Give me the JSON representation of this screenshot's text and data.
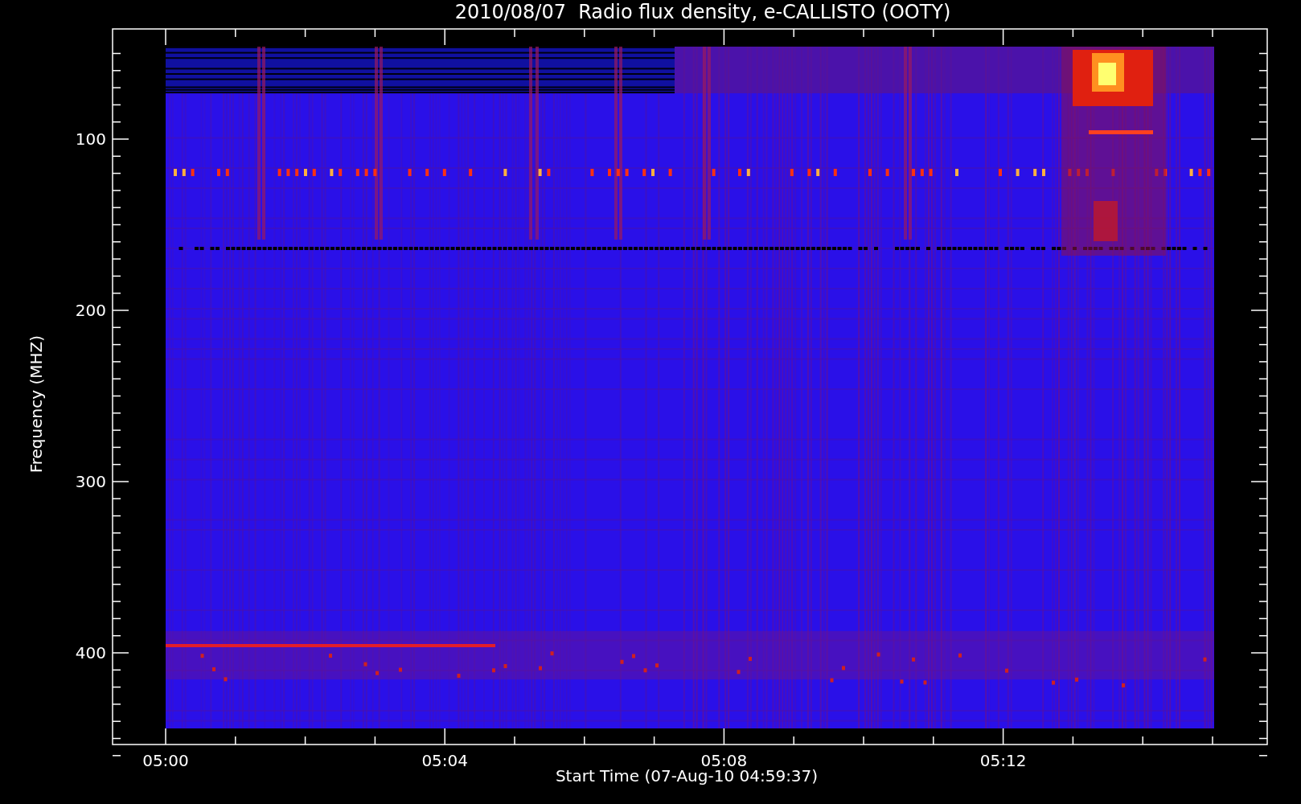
{
  "title": "2010/08/07  Radio flux density, e-CALLISTO (OOTY)",
  "chart": {
    "ylabel": "Frequency (MHZ)",
    "xlabel": "Start Time (07-Aug-10 04:59:37)",
    "xtick_labels": [
      "05:00",
      "05:04",
      "05:08",
      "05:12"
    ],
    "ytick_labels": [
      "100",
      "200",
      "300",
      "400"
    ]
  }
}
